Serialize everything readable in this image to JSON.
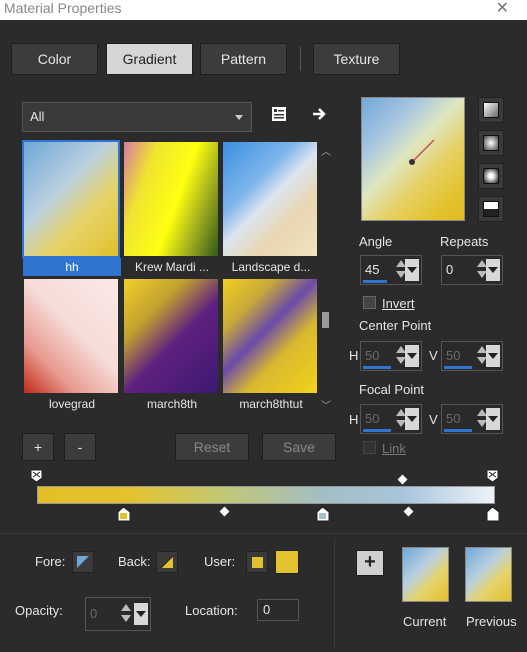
{
  "window": {
    "title": "Material Properties",
    "close_glyph": "✕"
  },
  "tabs": [
    {
      "label": "Color"
    },
    {
      "label": "Gradient"
    },
    {
      "label": "Pattern"
    },
    {
      "label": "Texture"
    }
  ],
  "category": {
    "value": "All"
  },
  "gallery": {
    "items": [
      {
        "name": "hh"
      },
      {
        "name": "Krew Mardi ..."
      },
      {
        "name": "Landscape d..."
      },
      {
        "name": "lovegrad"
      },
      {
        "name": "march8th"
      },
      {
        "name": "march8thtut"
      }
    ]
  },
  "settings": {
    "angle_label": "Angle",
    "angle_value": "45",
    "repeats_label": "Repeats",
    "repeats_value": "0",
    "invert_label": "Invert",
    "center_label": "Center Point",
    "center_h_label": "H",
    "center_h_value": "50",
    "center_v_label": "V",
    "center_v_value": "50",
    "focal_label": "Focal Point",
    "focal_h_label": "H",
    "focal_h_value": "50",
    "focal_v_label": "V",
    "focal_v_value": "50",
    "link_label": "Link"
  },
  "buttons": {
    "add": "+",
    "remove": "-",
    "reset": "Reset",
    "save": "Save"
  },
  "bottom": {
    "fore_label": "Fore:",
    "back_label": "Back:",
    "user_label": "User:",
    "opacity_label": "Opacity:",
    "opacity_value": "0",
    "location_label": "Location:",
    "location_value": "0",
    "add_glyph": "+",
    "current_label": "Current",
    "previous_label": "Previous"
  },
  "colors": {
    "accent": "#2f74d0",
    "yellow": "#e3c22f",
    "blue": "#6fa8d8"
  }
}
